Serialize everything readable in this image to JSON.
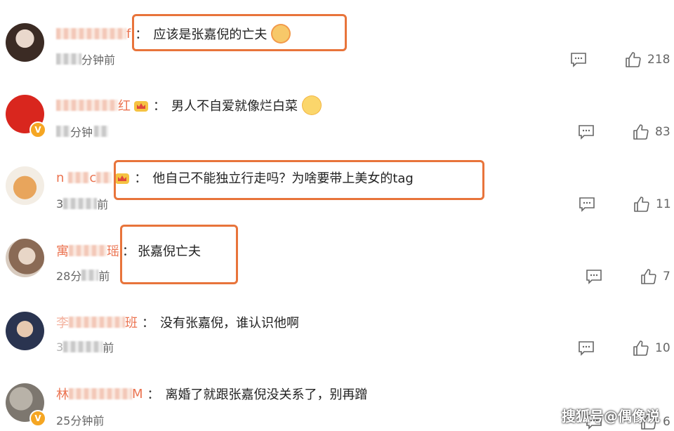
{
  "comments": [
    {
      "name_visible": "f",
      "text": "应该是张嘉倪的亡夫",
      "time_suffix": "分钟前",
      "likes": "218"
    },
    {
      "name_visible": "红",
      "text": "男人不自爱就像烂白菜",
      "time_suffix": "分钟",
      "likes": "83"
    },
    {
      "name_visible": "n",
      "name_visible_2": "c",
      "text": "他自己不能独立行走吗？为啥要带上美女的tag",
      "time_prefix": "3",
      "time_suffix": "前",
      "likes": "11"
    },
    {
      "name_visible": "寓",
      "name_visible_2": "瑶",
      "text": "张嘉倪亡夫",
      "time_prefix": "28分",
      "time_suffix": "前",
      "likes": "7"
    },
    {
      "name_visible": "李",
      "name_visible_2": "班",
      "text": "没有张嘉倪，谁认识他啊",
      "time_prefix": "3",
      "time_suffix": "前",
      "likes": "10"
    },
    {
      "name_visible": "林",
      "name_visible_2": "M",
      "text": "离婚了就跟张嘉倪没关系了，别再蹭",
      "time": "25分钟前",
      "likes": "6"
    }
  ],
  "watermark": "搜狐号@偶像说",
  "colors": {
    "accent": "#eb7350",
    "highlight": "#e8743b",
    "verified": "#f5a623"
  },
  "icons": {
    "comment": "comment-icon",
    "like": "thumbs-up-icon",
    "verified": "verified-badge-icon"
  }
}
